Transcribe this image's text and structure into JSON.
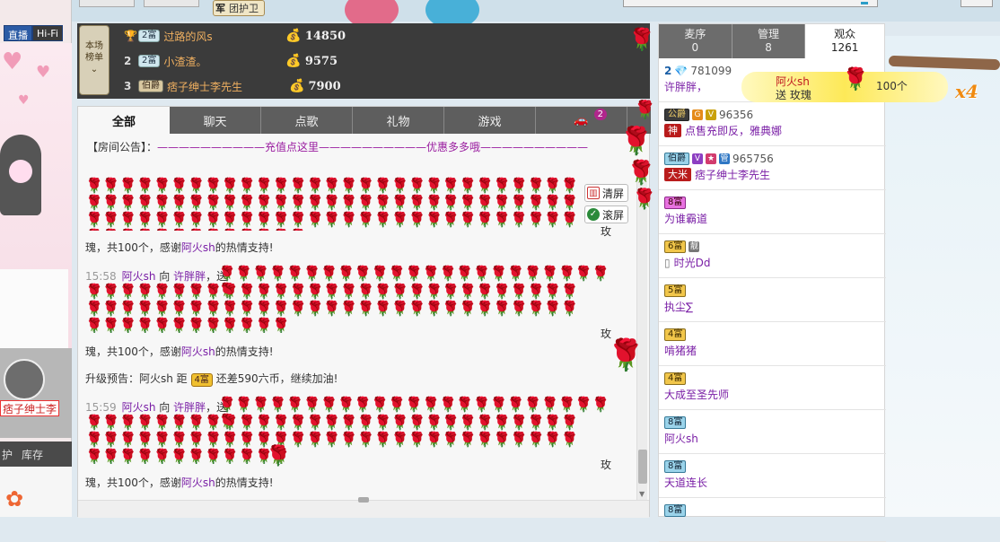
{
  "top": {
    "guard_pill_prefix": "军",
    "guard_pill_label": "团护卫"
  },
  "left": {
    "live_label": "直播",
    "hifi_label": "Hi-Fi",
    "host_name": "痞子绅士李",
    "tab_1": "护",
    "tab_2": "库存"
  },
  "rank": {
    "badge_text_1": "本场",
    "badge_text_2": "榜单",
    "badge_chevron": "⌄",
    "rows": [
      {
        "num": "",
        "level": "2富",
        "name": "过路的风s",
        "value": "14850"
      },
      {
        "num": "2",
        "level": "2富",
        "name": "小渣渣。",
        "value": "9575"
      },
      {
        "num": "3",
        "level": "伯爵",
        "name": "痞子绅士李先生",
        "value": "7900"
      }
    ]
  },
  "chat": {
    "tabs": [
      "全部",
      "聊天",
      "点歌",
      "礼物",
      "游戏",
      ""
    ],
    "tab_count": "2",
    "notice_label": "【房间公告】：",
    "notice_line1": "——————————",
    "notice_link1": "充值点这里",
    "notice_line2": "——————————",
    "notice_link2": "优惠多多哦",
    "notice_line3": "——————————",
    "clear_label": "清屏",
    "scroll_label": "滚屏",
    "msg1_time": "15:58",
    "msg1_from": "阿火sh",
    "msg1_verb": "向",
    "msg1_to": "许胖胖",
    "msg1_comma": "，送",
    "thanks_prefix": "瑰，共100个，感谢",
    "thanks_user": "阿火sh",
    "thanks_suffix": "的热情支持!",
    "gui_char": "玫",
    "upgrade_prefix": "升级预告：阿火sh 距",
    "upgrade_level": "4富",
    "upgrade_suffix": "还差590六币，继续加油!",
    "msg2_time": "15:59"
  },
  "audience": {
    "tabs": [
      {
        "label": "麦序",
        "count": "0"
      },
      {
        "label": "管理",
        "count": "8"
      },
      {
        "label": "观众",
        "count": "1261"
      }
    ],
    "items": [
      {
        "badge": "2",
        "id": "781099",
        "name": "许胖胖，"
      },
      {
        "badge": "公爵",
        "id": "96356",
        "tag": "神",
        "name": "点售充即反，雅典娜"
      },
      {
        "badge": "伯爵",
        "id": "965756",
        "tag": "大米",
        "name": "痞子绅士李先生"
      },
      {
        "badge": "8富",
        "name": "为谁霸道"
      },
      {
        "badge": "6富",
        "name": "时光Dd"
      },
      {
        "badge": "5富",
        "name": "执尘∑"
      },
      {
        "badge": "4富",
        "name": "啃猪猪"
      },
      {
        "badge": "4富",
        "name": "大成至圣先师"
      },
      {
        "badge": "8富",
        "name": "阿火sh"
      },
      {
        "badge": "8富",
        "name": "天道连长"
      },
      {
        "badge": "8富",
        "name": ""
      }
    ]
  },
  "gift": {
    "user": "阿火sh",
    "action": "送 玫瑰",
    "count": "100个",
    "multiplier": "x4"
  },
  "colors": {
    "accent_purple": "#7a1fa6",
    "rose_red": "#d40e1e",
    "dark_panel": "#3b3b3b"
  }
}
